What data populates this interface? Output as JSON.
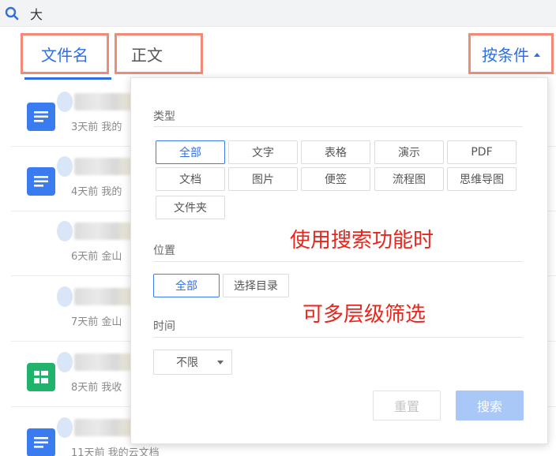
{
  "search": {
    "query": "大"
  },
  "tabs": {
    "filename": "文件名",
    "body": "正文",
    "conditions": "按条件"
  },
  "files": [
    {
      "meta": "3天前  我的",
      "icon": "doc-icon"
    },
    {
      "meta": "4天前  我的",
      "icon": "doc-icon"
    },
    {
      "meta": "6天前  金山",
      "icon": "image-icon"
    },
    {
      "meta": "7天前  金山",
      "icon": "image-icon"
    },
    {
      "meta": "8天前  我收",
      "icon": "sheet-icon"
    },
    {
      "meta": "11天前  我的云文档",
      "icon": "doc-icon"
    }
  ],
  "filter": {
    "type_label": "类型",
    "types": [
      "全部",
      "文字",
      "表格",
      "演示",
      "PDF",
      "文档",
      "图片",
      "便签",
      "流程图",
      "思维导图",
      "文件夹"
    ],
    "location_label": "位置",
    "locations": [
      "全部",
      "选择目录"
    ],
    "time_label": "时间",
    "time_value": "不限",
    "reset_label": "重置",
    "search_label": "搜索"
  },
  "annotations": {
    "line1": "使用搜索功能时",
    "line2": "可多层级筛选"
  },
  "colors": {
    "accent": "#2e6fe6",
    "highlight_box": "#f28a78",
    "annotation": "#e8261c",
    "doc": "#3a7cf0",
    "image": "#8a5bd8",
    "sheet": "#21b36b"
  }
}
